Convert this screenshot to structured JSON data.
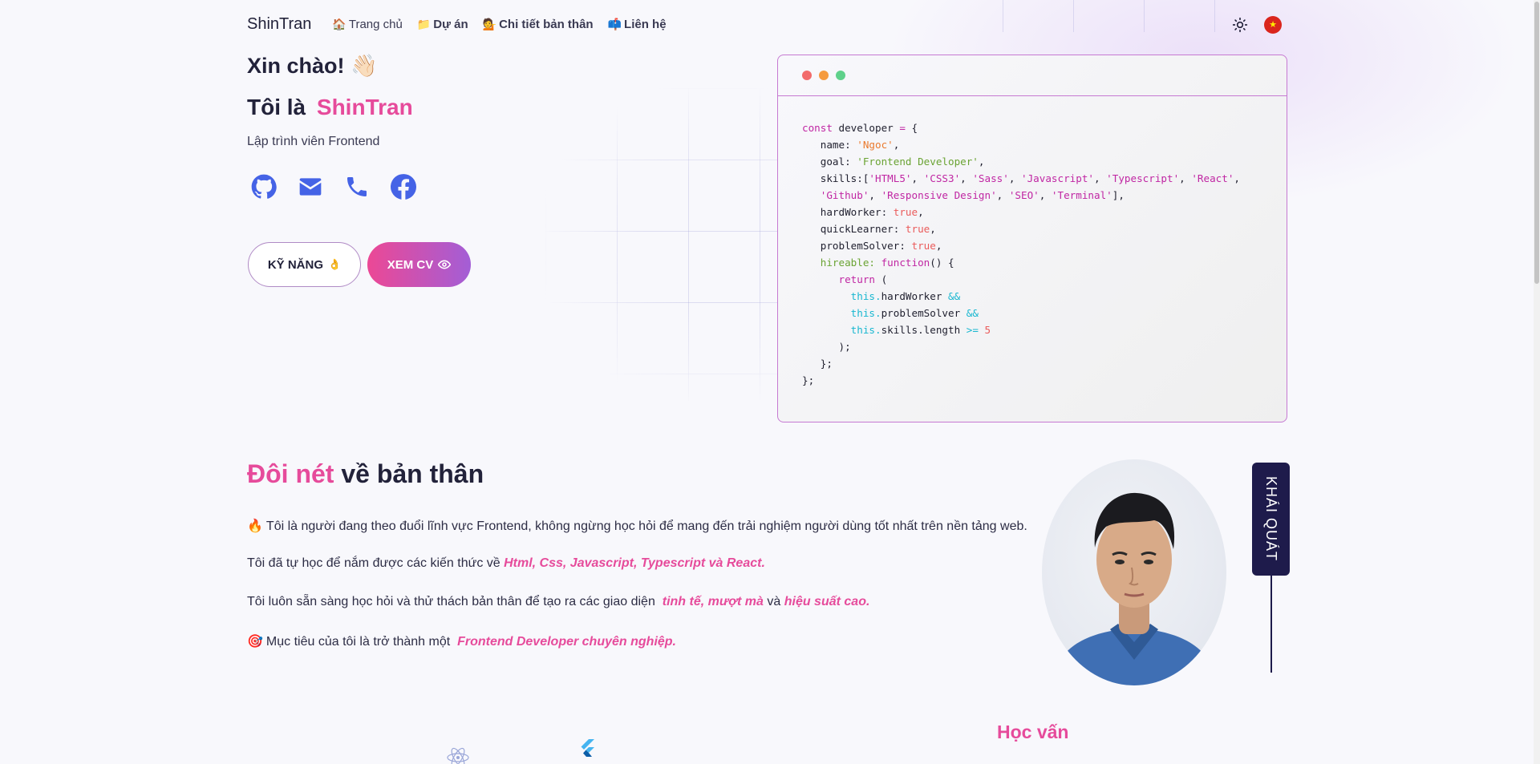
{
  "nav": {
    "logo": "ShinTran",
    "items": [
      {
        "emoji": "🏠",
        "label": "Trang chủ"
      },
      {
        "emoji": "📁",
        "label": "Dự án"
      },
      {
        "emoji": "💁",
        "label": "Chi tiết bản thân"
      },
      {
        "emoji": "📫",
        "label": "Liên hệ"
      }
    ],
    "flag": "★"
  },
  "hero": {
    "greeting": "Xin chào!",
    "greeting_emoji": "👋🏻",
    "intro_prefix": "Tôi là",
    "name": "ShinTran",
    "role": "Lập trình viên Frontend",
    "socials": [
      "github-icon",
      "mail-icon",
      "phone-icon",
      "facebook-icon"
    ],
    "btn_skill": "KỸ NĂNG",
    "btn_skill_emoji": "👌",
    "btn_cv": "XEM CV"
  },
  "code": {
    "dots": [
      "#f26b6b",
      "#f59b3f",
      "#5fd18b"
    ]
  },
  "about": {
    "title_hl": "Đôi nét",
    "title_rest": "về bản thân",
    "p1_emoji": "🔥",
    "p1": "Tôi là người đang theo đuổi lĩnh vực Frontend, không ngừng học hỏi để mang đến trải nghiệm người dùng tốt nhất trên nền tảng web.",
    "p2": "Tôi đã tự học để nắm được các kiến thức về",
    "p2_em": "Html, Css, Javascript, Typescript và React.",
    "p3": "Tôi luôn sẵn sàng học hỏi và thử thách bản thân để tạo ra các giao diện",
    "p3_em1": "tinh tế, mượt mà",
    "p3_mid": "và",
    "p3_em2": "hiệu suất cao.",
    "p4_emoji": "🎯",
    "p4": "Mục tiêu của tôi là trở thành một",
    "p4_em": "Frontend Developer chuyên nghiệp.",
    "side_tab": "KHÁI QUÁT"
  },
  "education": {
    "title": "Học vấn"
  }
}
